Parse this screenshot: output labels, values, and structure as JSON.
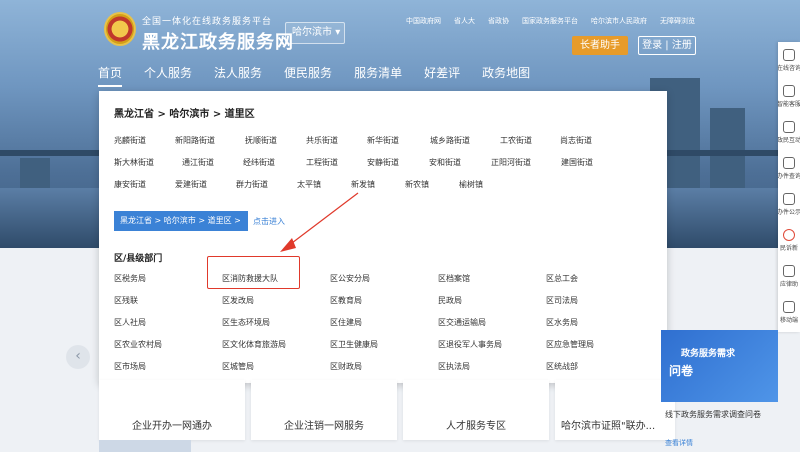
{
  "header": {
    "logo_top": "全国一体化在线政务服务平台",
    "logo_main": "黑龙江政务服务网",
    "city_select": "哈尔滨市",
    "top_links": [
      "中国政府网",
      "省人大",
      "省政协",
      "国家政务服务平台",
      "哈尔滨市人民政府",
      "无障碍浏览"
    ],
    "elder_button": "长者助手",
    "login": "登录",
    "register": "注册"
  },
  "nav": [
    "首页",
    "个人服务",
    "法人服务",
    "便民服务",
    "服务清单",
    "好差评",
    "政务地图"
  ],
  "right_bar": [
    "在线咨询",
    "智能客服",
    "政民互动",
    "办件查询",
    "办件公示",
    "民诉新",
    "应律助",
    "移动端"
  ],
  "panel": {
    "crumb": "黑龙江省 > 哈尔滨市 > 道里区",
    "streets": [
      [
        "兆麟街道",
        "新阳路街道",
        "抚顺街道",
        "共乐街道",
        "新华街道",
        "城乡路街道",
        "工农街道",
        "尚志街道"
      ],
      [
        "斯大林街道",
        "通江街道",
        "经纬街道",
        "工程街道",
        "安静街道",
        "安和街道",
        "正阳河街道",
        "建国街道"
      ],
      [
        "康安街道",
        "爱建街道",
        "群力街道",
        "太平镇",
        "新发镇",
        "新农镇",
        "榆树镇"
      ]
    ],
    "location_box": "黑龙江省 > 哈尔滨市 > 道里区 >",
    "enter_link": "点击进入",
    "dept_title": "区/县级部门",
    "depts": [
      [
        "区税务局",
        "区消防救援大队",
        "区公安分局",
        "区档案馆",
        "区总工会"
      ],
      [
        "区残联",
        "区发改局",
        "区教育局",
        "民政局",
        "区司法局"
      ],
      [
        "区人社局",
        "区生态环境局",
        "区住建局",
        "区交通运输局",
        "区水务局"
      ],
      [
        "区农业农村局",
        "区文化体育旅游局",
        "区卫生健康局",
        "区退役军人事务局",
        "区应急管理局"
      ],
      [
        "区市场局",
        "区城管局",
        "区财政局",
        "区执法局",
        "区统战部"
      ]
    ]
  },
  "cards": [
    "企业开办一网通办",
    "企业注销一网服务",
    "人才服务专区",
    "哈尔滨市证照\"联办..."
  ],
  "promo": {
    "title1": "政务服务需求",
    "title2": "问卷",
    "caption": "线下政务服务需求调查问卷",
    "more": "查看详情"
  },
  "colors": {
    "accent": "#3b82d6",
    "highlight": "#e0392b",
    "elder": "#e79b2a"
  }
}
